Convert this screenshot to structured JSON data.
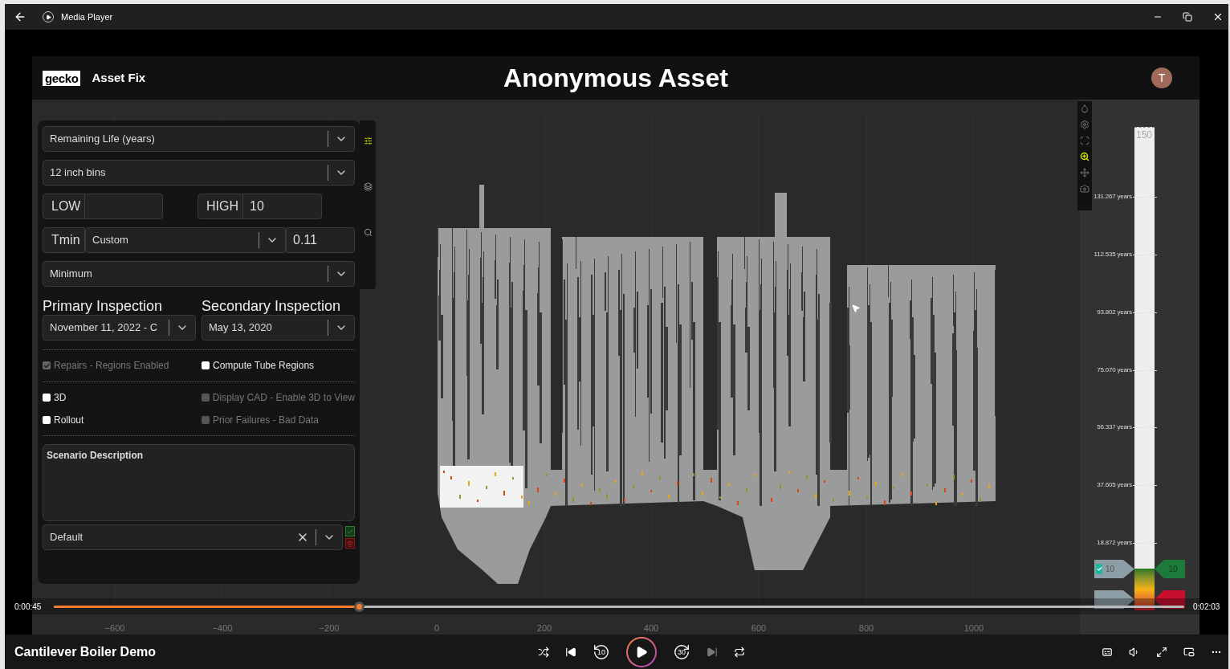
{
  "window": {
    "title": "Media Player"
  },
  "video": {
    "header": {
      "logo": "gecko",
      "app_name": "Asset Fix",
      "title": "Anonymous Asset",
      "avatar": "T"
    },
    "panel_tabs": [
      {
        "kind": "sliders",
        "selected": true
      },
      {
        "kind": "layers",
        "selected": false
      },
      {
        "kind": "search",
        "selected": false
      }
    ],
    "panel": {
      "metric": "Remaining Life (years)",
      "bins": "12 inch bins",
      "low": {
        "label": "LOW"
      },
      "high": {
        "label": "HIGH",
        "value": "10"
      },
      "tmin": {
        "label": "Tmin",
        "mode": "Custom",
        "value": "0.11"
      },
      "aggregate": "Minimum",
      "inspections": [
        {
          "heading": "Primary Inspection",
          "value": "November 11, 2022 - C"
        },
        {
          "heading": "Secondary Inspection",
          "value": "May 13, 2020"
        }
      ],
      "option_groups": [
        [
          {
            "label": "Repairs - Regions Enabled",
            "checked": true,
            "disabled": true
          },
          {
            "label": "Compute Tube Regions",
            "checked": false,
            "disabled": false
          }
        ],
        [
          {
            "label": "3D",
            "checked": false,
            "disabled": false
          },
          {
            "label": "Display CAD - Enable 3D to View",
            "checked": false,
            "disabled": true
          },
          {
            "label": "Rollout",
            "checked": false,
            "disabled": false
          },
          {
            "label": "Prior Failures - Bad Data",
            "checked": false,
            "disabled": true
          }
        ]
      ],
      "description": "Scenario Description",
      "scenario": "Default"
    },
    "plot": {
      "x_ticks": [
        "−600",
        "−400",
        "−200",
        "0",
        "200",
        "400",
        "600",
        "800",
        "1000"
      ]
    },
    "plot_toolbar": [
      {
        "kind": "drop",
        "selected": false
      },
      {
        "kind": "settings",
        "selected": false
      },
      {
        "kind": "fit",
        "selected": false
      },
      {
        "kind": "zoom",
        "selected": true
      },
      {
        "kind": "pan",
        "selected": false
      },
      {
        "kind": "camera",
        "selected": false
      }
    ],
    "colorbar": {
      "top_label": "150",
      "ticks": [
        "131.267 years",
        "112.535 years",
        "93.802 years",
        "75.070 years",
        "56.337 years",
        "37.605 years",
        "18.872 years"
      ],
      "threshold": {
        "checked": true,
        "low": "10",
        "high": "10"
      }
    }
  },
  "player": {
    "elapsed": "0:00:45",
    "duration": "0:02:03",
    "level": 0.27,
    "title": "Cantilever Boiler Demo",
    "replay_label": "10",
    "forward_label": "30",
    "next_disabled": true
  }
}
